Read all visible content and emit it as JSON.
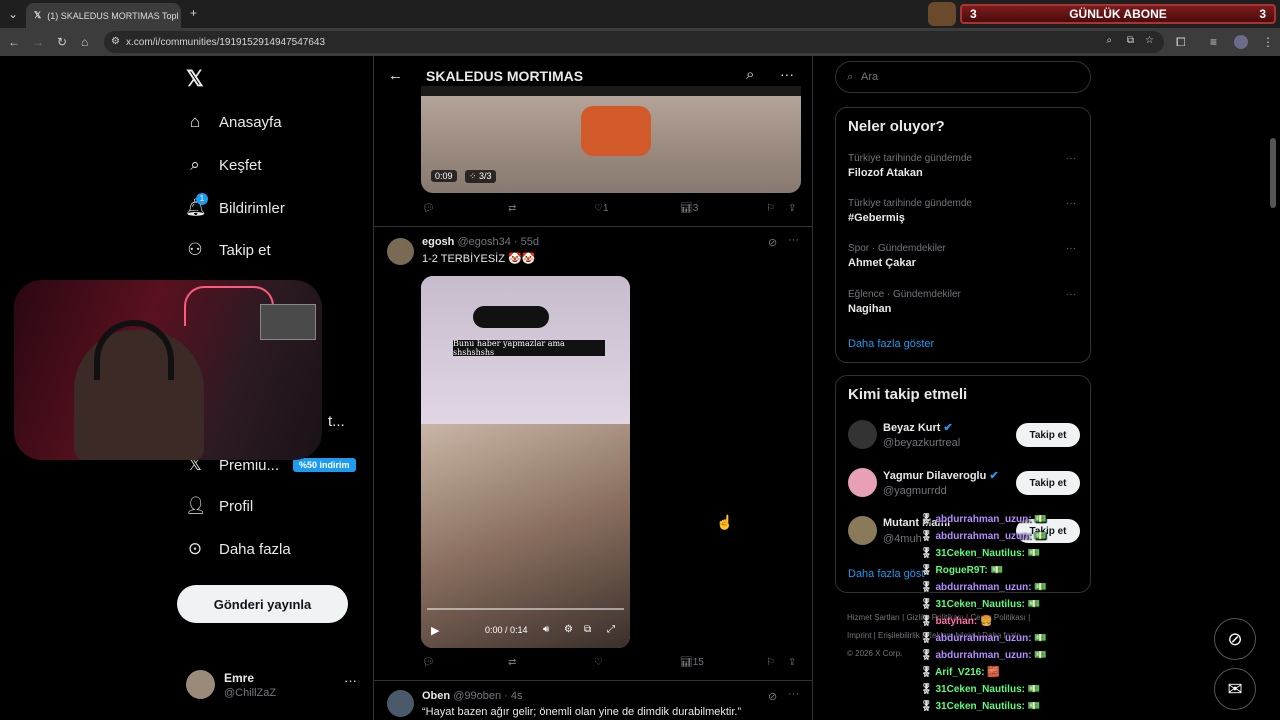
{
  "browser": {
    "tab_title": "(1) SKALEDUS MORTIMAS Topl",
    "url": "x.com/i/communities/1919152914947547643"
  },
  "overlay": {
    "abone_count_left": "3",
    "abone_label": "GÜNLÜK ABONE",
    "abone_count_right": "3"
  },
  "nav": {
    "home": "Anasayfa",
    "explore": "Keşfet",
    "notifications": "Bildirimler",
    "notif_badge": "1",
    "follow": "Takip et",
    "hidden_item": "t...",
    "premium": "Premiu...",
    "premium_badge": "%50 indirim",
    "profile": "Profil",
    "more": "Daha fazla",
    "post_button": "Gönderi yayınla"
  },
  "account": {
    "name": "Emre",
    "handle": "@ChillZaZ"
  },
  "community": {
    "title": "SKALEDUS MORTIMAS"
  },
  "posts": [
    {
      "video_time": "0:09",
      "media_count": "3/3",
      "likes": "1",
      "views": "3"
    },
    {
      "author": "egosh",
      "handle": "@egosh34",
      "time": "· 55d",
      "text": "1-2 TERBİYESİZ 🤡🤡",
      "overlay_text": "Bunu haber yapmazlar ama shshshshs",
      "video_time": "0:00 / 0:14",
      "views": "15"
    },
    {
      "author": "Oben",
      "handle": "@99oben",
      "time": "· 4s",
      "text": "“Hayat bazen ağır gelir; önemli olan yine de dimdik durabilmektir.”"
    }
  ],
  "search": {
    "placeholder": "Ara"
  },
  "trends": {
    "title": "Neler oluyor?",
    "items": [
      {
        "context": "Türkiye tarihinde gündemde",
        "name": "Filozof Atakan"
      },
      {
        "context": "Türkiye tarihinde gündemde",
        "name": "#Gebermiş"
      },
      {
        "context": "Spor · Gündemdekiler",
        "name": "Ahmet Çakar"
      },
      {
        "context": "Eğlence · Gündemdekiler",
        "name": "Nagihan"
      }
    ],
    "show_more": "Daha fazla göster"
  },
  "who_to_follow": {
    "title": "Kimi takip etmeli",
    "users": [
      {
        "name": "Beyaz Kurt",
        "handle": "@beyazkurtreal",
        "button": "Takip et"
      },
      {
        "name": "Yagmur Dilaveroglu",
        "handle": "@yagmurrdd",
        "button": "Takip et"
      },
      {
        "name": "Mutant Mami",
        "handle": "@4muh",
        "button": "Takip et"
      }
    ],
    "show_more": "Daha fazla göst"
  },
  "footer": {
    "links": [
      "Hizmet Şartları",
      "Gizlilik Politikası",
      "Çerez Politikası",
      "Imprint",
      "Erişilebilirlik",
      "Reklam bilgisi",
      "Daha fazla ..."
    ],
    "copyright": "© 2026 X Corp."
  },
  "chat": [
    {
      "user": "abdurrahman_uzun:",
      "msg": "💵",
      "color": "#b48cff"
    },
    {
      "user": "abdurrahman_uzun:",
      "msg": "💵",
      "color": "#b48cff"
    },
    {
      "user": "31Ceken_Nautilus:",
      "msg": "💵",
      "color": "#5dfc7a"
    },
    {
      "user": "RogueR9T:",
      "msg": "💵",
      "color": "#5dfc7a"
    },
    {
      "user": "abdurrahman_uzun:",
      "msg": "💵",
      "color": "#b48cff"
    },
    {
      "user": "31Ceken_Nautilus:",
      "msg": "💵",
      "color": "#5dfc7a"
    },
    {
      "user": "batyhan:",
      "msg": "🍔",
      "color": "#ff6fa8"
    },
    {
      "user": "abdurrahman_uzun:",
      "msg": "💵",
      "color": "#b48cff"
    },
    {
      "user": "abdurrahman_uzun:",
      "msg": "💵",
      "color": "#b48cff"
    },
    {
      "user": "Arif_V216:",
      "msg": "🧱",
      "color": "#5dfc7a"
    },
    {
      "user": "31Ceken_Nautilus:",
      "msg": "💵",
      "color": "#5dfc7a"
    },
    {
      "user": "31Ceken_Nautilus:",
      "msg": "💵",
      "color": "#5dfc7a"
    }
  ]
}
